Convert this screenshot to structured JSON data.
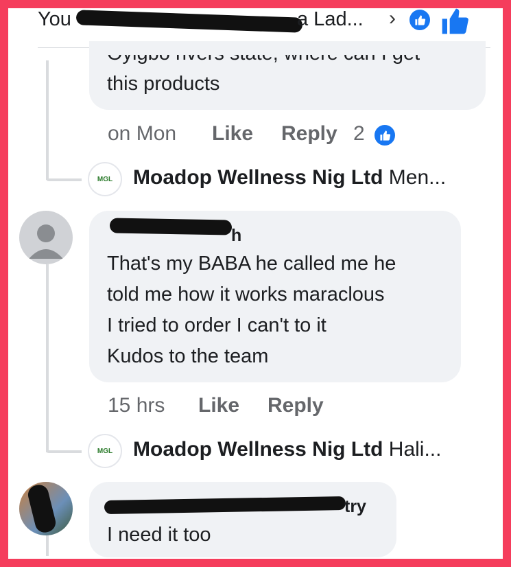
{
  "header": {
    "title_start": "You",
    "title_end": "a Lad...",
    "chevron": "›",
    "like_icon": "thumbs-up-icon"
  },
  "comments": [
    {
      "text": "this products",
      "time": "on Mon",
      "like_label": "Like",
      "reply_label": "Reply",
      "reaction_count": "2",
      "reply_preview": {
        "name": "Moadop Wellness Nig Ltd",
        "text": "Men...",
        "avatar_label": "MGL"
      }
    },
    {
      "author": "h",
      "text": "That's my BABA he called me he\ntold me how it works maraclous\nI tried to order I can't to it\nKudos to the team",
      "time": "15 hrs",
      "like_label": "Like",
      "reply_label": "Reply",
      "reply_preview": {
        "name": "Moadop Wellness Nig Ltd",
        "text": "Hali...",
        "avatar_label": "MGL"
      }
    },
    {
      "author": "try",
      "text": "I need it too"
    }
  ],
  "colors": {
    "frame": "#f53d5c",
    "bubble": "#f0f2f5",
    "like_blue": "#1877f2",
    "meta_gray": "#65676b"
  }
}
